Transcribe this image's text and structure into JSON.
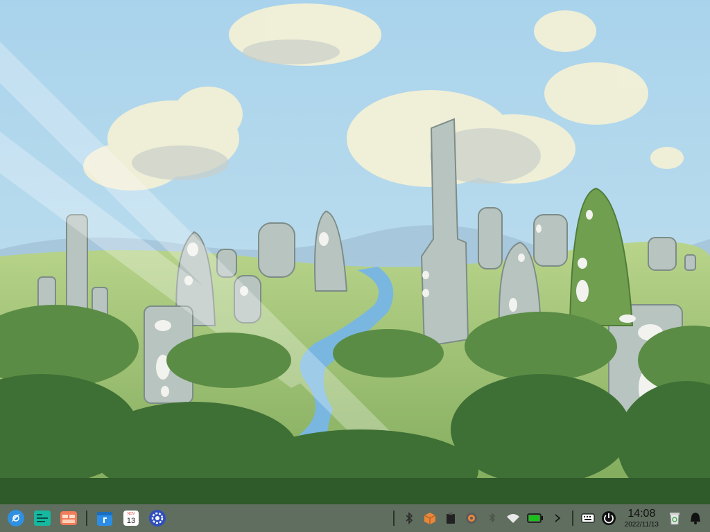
{
  "desktop": {
    "wallpaper": "standing-stones-landscape",
    "colors": {
      "sky": "#b3d8ea",
      "grass": "#8fb768",
      "forest": "#4f7f3f",
      "stone": "#b8c4c0",
      "river": "#79b7e0"
    }
  },
  "taskbar": {
    "background": "#5f6e5e",
    "launcher_icon": "launcher-icon",
    "apps": [
      {
        "name": "multitasking-view",
        "icon": "multitask-icon"
      },
      {
        "name": "file-manager",
        "icon": "folder-icon"
      },
      {
        "name": "app-store",
        "icon": "store-icon"
      },
      {
        "name": "calendar",
        "icon": "calendar-icon",
        "month": "NOV",
        "day": "13"
      },
      {
        "name": "control-center",
        "icon": "gear-icon"
      }
    ],
    "tray": {
      "icons": [
        "bluetooth-icon",
        "package-icon",
        "clipboard-icon",
        "screenshot-icon",
        "bluetooth-off-icon",
        "wifi-icon",
        "battery-icon",
        "expand-arrow-icon"
      ],
      "keyboard_icon": "keyboard-icon",
      "power_icon": "power-icon",
      "time": "14:08",
      "date": "2022/11/13",
      "trash_icon": "trash-icon",
      "notification_icon": "bell-icon"
    }
  }
}
